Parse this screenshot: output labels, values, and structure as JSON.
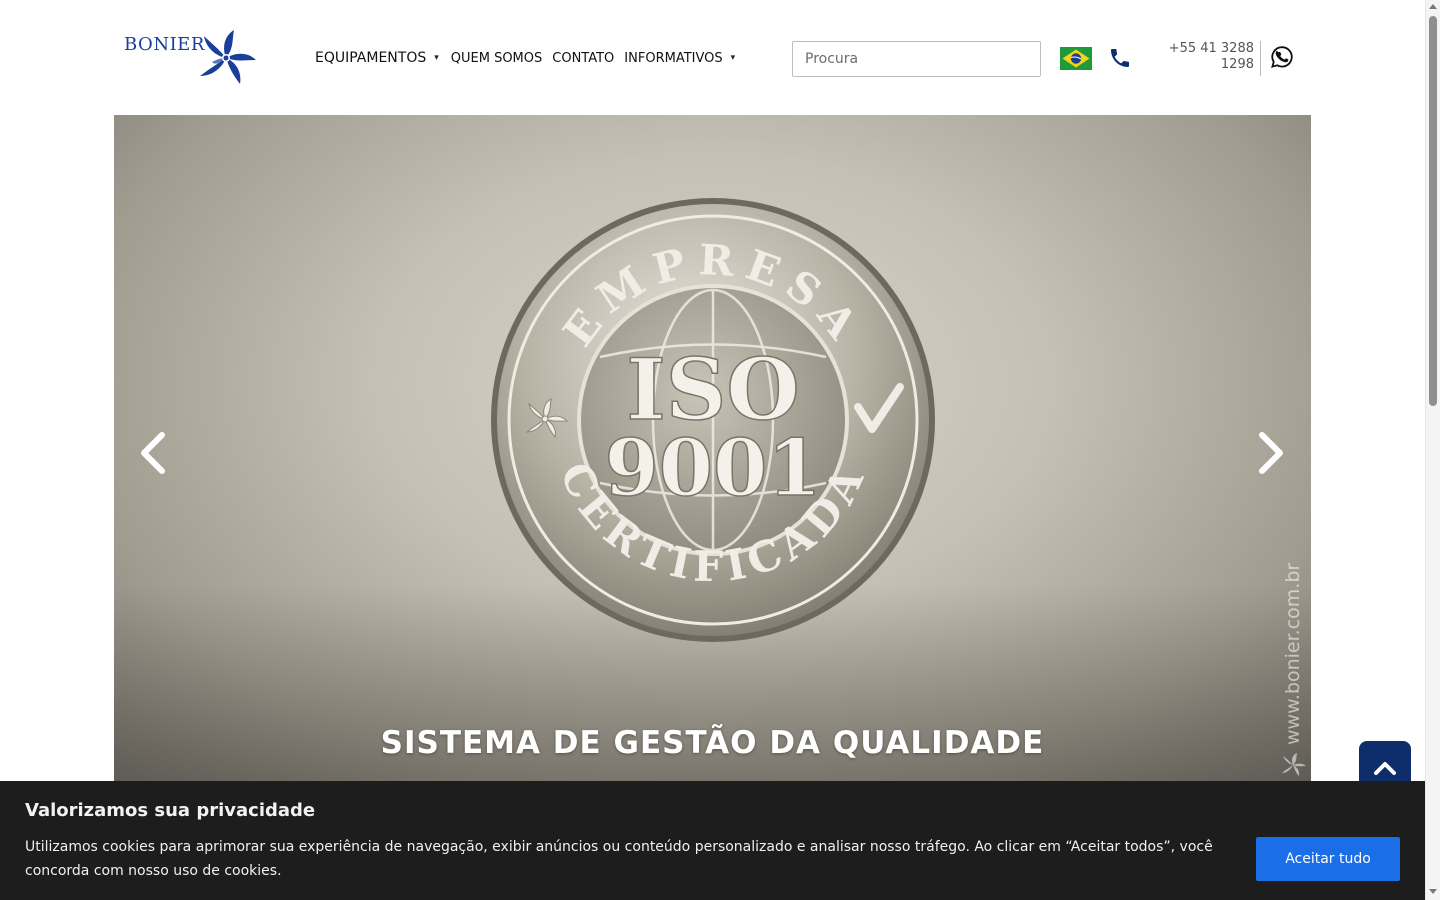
{
  "header": {
    "logo_text": "BONIER",
    "nav": [
      {
        "label": "EQUIPAMENTOS",
        "dropdown": true
      },
      {
        "label": "QUEM SOMOS",
        "dropdown": false
      },
      {
        "label": "CONTATO",
        "dropdown": false
      },
      {
        "label": "INFORMATIVOS",
        "dropdown": true
      }
    ],
    "caret": "▾",
    "search_placeholder": "Procura",
    "phone_number": "+55 41 3288 1298",
    "icons": {
      "flag": "brazil-flag-icon",
      "phone": "phone-icon",
      "whatsapp": "whatsapp-icon"
    }
  },
  "carousel": {
    "caption": "SISTEMA DE GESTÃO DA QUALIDADE",
    "coin": {
      "top_text": "EMPRESA",
      "center_line1": "ISO",
      "center_line2": "9001",
      "bottom_text": "CERTIFICADA"
    },
    "watermark": "www.bonier.com.br",
    "prev_icon": "chevron-left-icon",
    "next_icon": "chevron-right-icon"
  },
  "back_to_top": {
    "icon": "chevron-up-icon"
  },
  "cookie_banner": {
    "title": "Valorizamos sua privacidade",
    "text": "Utilizamos cookies para aprimorar sua experiência de navegação, exibir anúncios ou conteúdo personalizado e analisar nosso tráfego. Ao clicar em “Aceitar todos”, você concorda com nosso uso de cookies.",
    "accept_label": "Aceitar tudo"
  },
  "colors": {
    "brand_blue": "#1a3f9a",
    "back_to_top": "#0d2d6b",
    "accept_button": "#1a6ee8",
    "banner_bg": "#1d1d1d"
  }
}
